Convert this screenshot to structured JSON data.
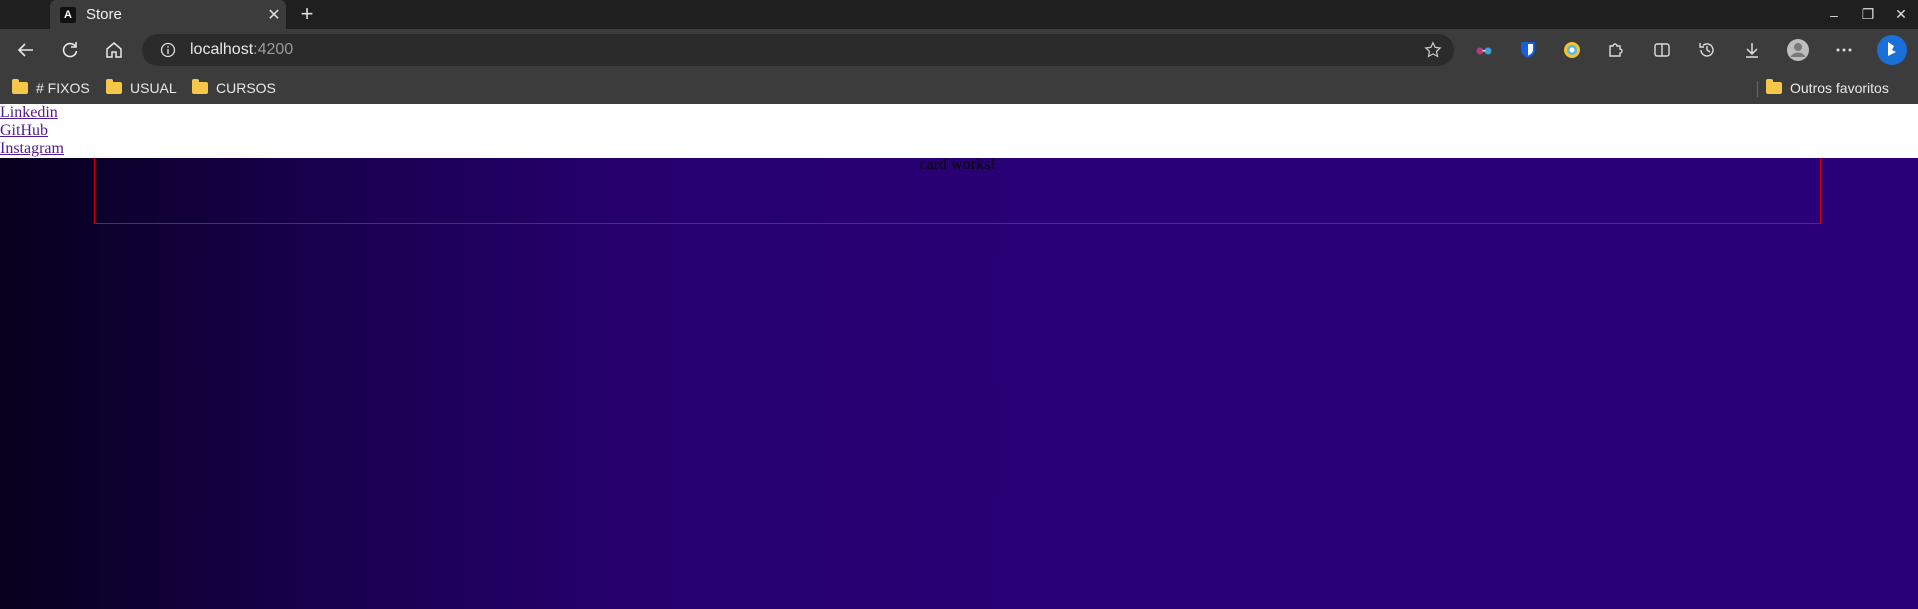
{
  "browser": {
    "tab": {
      "favicon": "A",
      "title": "Store",
      "close": "✕"
    },
    "new_tab": "+",
    "window_controls": {
      "minimize": "–",
      "restore": "❐",
      "close": "✕"
    },
    "address": {
      "host": "localhost",
      "port": ":4200"
    },
    "bookmarks": {
      "items": [
        "# FIXOS",
        "USUAL",
        "CURSOS"
      ],
      "other": "Outros favoritos"
    }
  },
  "page": {
    "links": [
      "Linkedin",
      "GitHub",
      "Instagram"
    ],
    "card_text": "card works!"
  },
  "colors": {
    "page_background": "#2a0078",
    "card_border": "#d40000",
    "link": "#551a8b"
  }
}
